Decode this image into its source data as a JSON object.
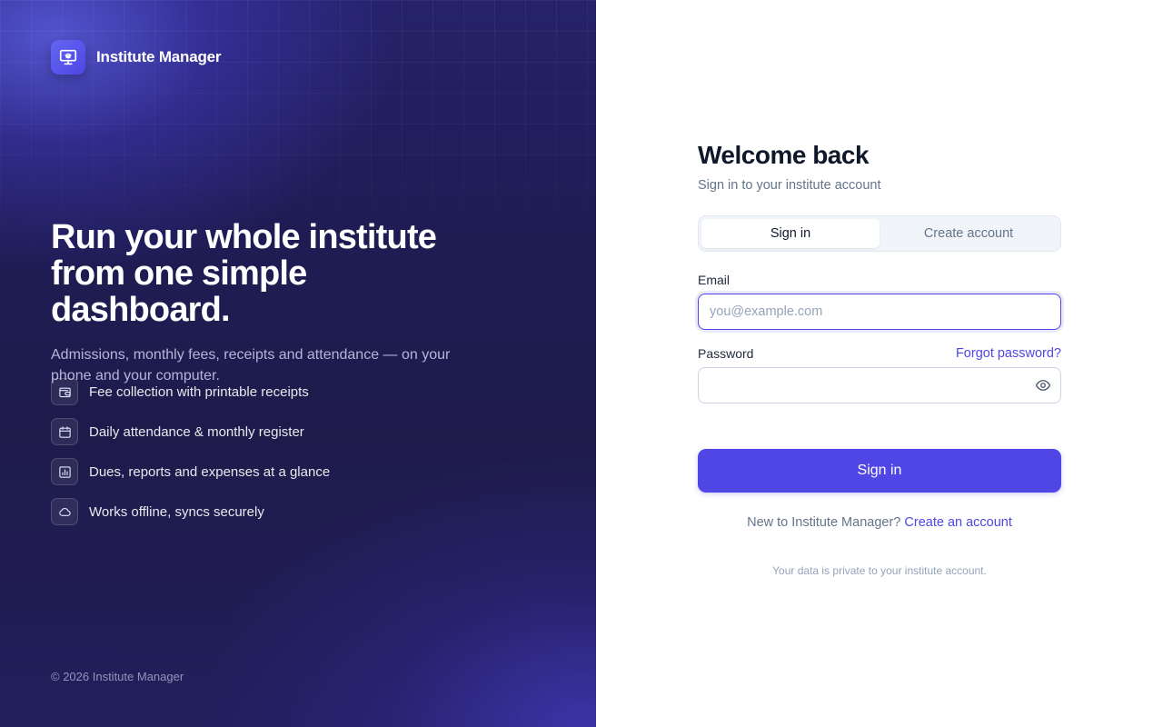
{
  "brand": {
    "name": "Institute Manager",
    "logo_icon": "presentation-board-icon",
    "accent_color": "#4f46e5"
  },
  "hero": {
    "title_line1": "Run your whole institute",
    "title_line2": "from one simple dashboard.",
    "subtitle": "Admissions, monthly fees, receipts and attendance — on your phone and your computer."
  },
  "features": [
    {
      "icon": "wallet-icon",
      "label": "Fee collection with printable receipts"
    },
    {
      "icon": "calendar-icon",
      "label": "Daily attendance & monthly register"
    },
    {
      "icon": "bar-chart-icon",
      "label": "Dues, reports and expenses at a glance"
    },
    {
      "icon": "cloud-icon",
      "label": "Works offline, syncs securely"
    }
  ],
  "footer": {
    "copyright": "© 2026 Institute Manager"
  },
  "form": {
    "title": "Welcome back",
    "subtitle": "Sign in to your institute account",
    "tabs": [
      {
        "label": "Sign in",
        "active": true
      },
      {
        "label": "Create account",
        "active": false
      }
    ],
    "email": {
      "label": "Email",
      "placeholder": "you@example.com",
      "value": ""
    },
    "password": {
      "label": "Password",
      "value": "",
      "forgot_label": "Forgot password?",
      "toggle_icon": "eye-icon"
    },
    "submit_label": "Sign in",
    "signup_prompt": "New to Institute Manager?",
    "signup_link": "Create an account",
    "privacy_note": "Your data is private to your institute account."
  }
}
